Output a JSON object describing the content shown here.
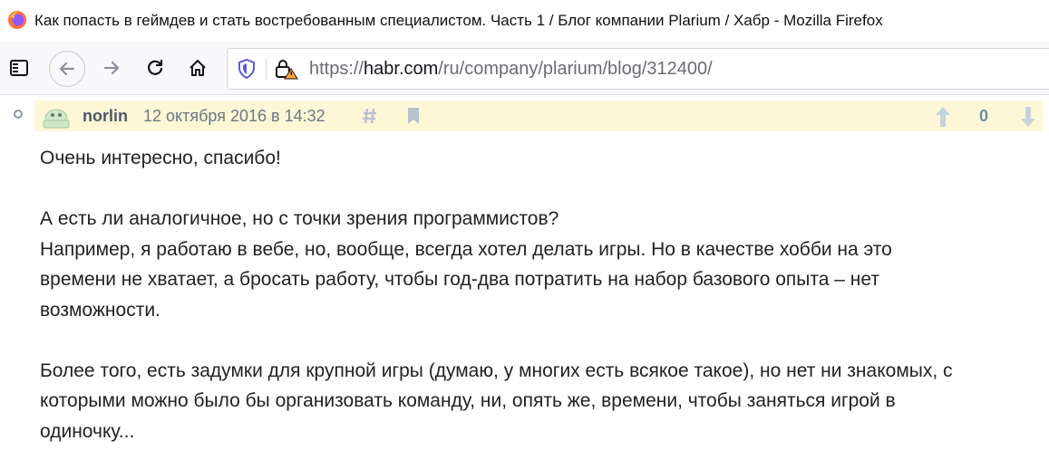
{
  "window": {
    "title": "Как попасть в геймдев и стать востребованным специалистом. Часть 1 / Блог компании Plarium / Хабр - Mozilla Firefox"
  },
  "navbar": {
    "url_prefix": "https://",
    "url_host": "habr.com",
    "url_path": "/ru/company/plarium/blog/312400/"
  },
  "comment": {
    "author": "norlin",
    "time": "12 октября 2016 в 14:32",
    "votes": "0",
    "paragraphs": [
      "Очень интересно, спасибо!",
      "А есть ли аналогичное, но с точки зрения программистов?",
      "Например, я работаю в вебе, но, вообще, всегда хотел делать игры. Но в качестве хобби на это",
      "времени не хватает, а бросать работу, чтобы год-два потратить на набор базового опыта – нет",
      "возможности.",
      "Более того, есть задумки для крупной игры (думаю, у многих есть всякое такое), но нет ни знакомых, с",
      "которыми можно было бы организовать команду, ни, опять же, времени, чтобы заняться игрой в",
      "одиночку..."
    ]
  },
  "colors": {
    "comment_header_bg": "#fdf7d7",
    "author": "#4a5a66",
    "votes": "#6e8fa6"
  }
}
